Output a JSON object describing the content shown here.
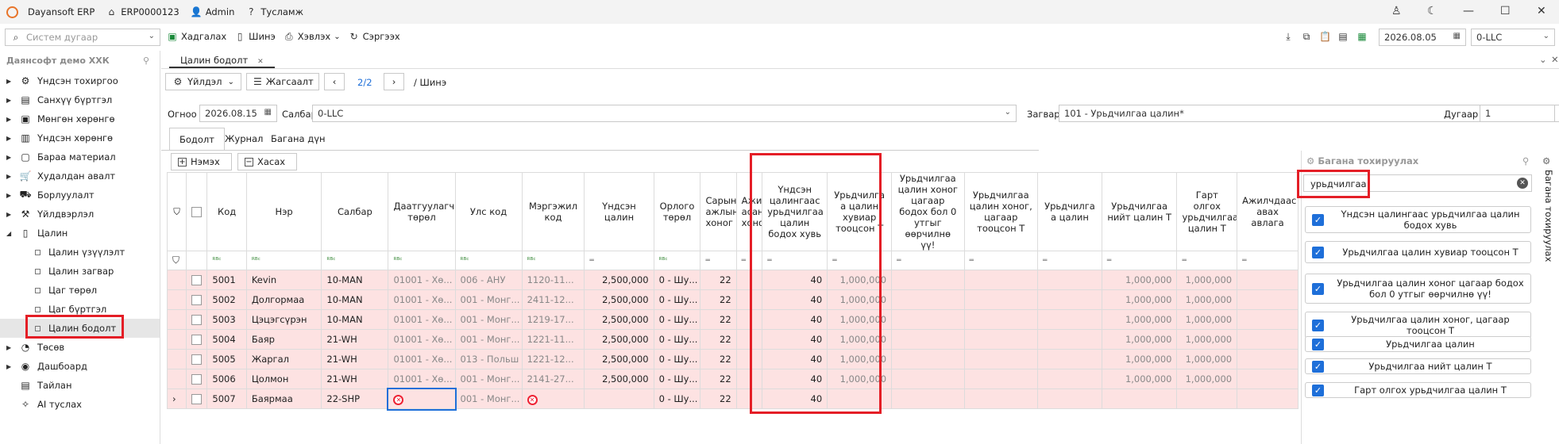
{
  "titlebar": {
    "app": "Dayansoft ERP",
    "code": "ERP0000123",
    "user": "Admin",
    "help": "Тусламж"
  },
  "toolbar": {
    "search_placeholder": "Систем дугаар",
    "save": "Хадгалах",
    "new": "Шинэ",
    "print": "Хэвлэх",
    "refresh": "Сэргээх",
    "date": "2026.08.05",
    "branch": "0-LLC"
  },
  "sidebar": {
    "company": "Даянсофт демо ХХК",
    "items": [
      "Үндсэн тохиргоо",
      "Санхүү бүртгэл",
      "Мөнгөн хөрөнгө",
      "Үндсэн хөрөнгө",
      "Бараа материал",
      "Худалдан авалт",
      "Борлуулалт",
      "Үйлдвэрлэл",
      "Цалин"
    ],
    "subitems": [
      "Цалин үзүүлэлт",
      "Цалин загвар",
      "Цаг төрөл",
      "Цаг бүртгэл",
      "Цалин бодолт"
    ],
    "bottom": [
      "Төсөв",
      "Дашбоард",
      "Тайлан",
      "AI туслах"
    ]
  },
  "main": {
    "tab": "Цалин бодолт",
    "action": "Үйлдэл",
    "list": "Жагсаалт",
    "pager": "2/2",
    "crumb": "/ Шинэ",
    "form": {
      "date_label": "Огноо",
      "date": "2026.08.15",
      "branch_label": "Салбар",
      "branch": "0-LLC",
      "template_label": "Загвар",
      "template": "101 - Урьдчилгаа цалин*",
      "num_label": "Дугаар",
      "num": "1"
    },
    "subtabs": [
      "Бодолт",
      "Журнал",
      "Багана дүн"
    ],
    "add": "Нэмэх",
    "remove": "Хасах"
  },
  "grid": {
    "headers": [
      "Код",
      "Нэр",
      "Салбар",
      "Даатгуулагч төрөл",
      "Улс код",
      "Мэргэжил код",
      "Үндсэн цалин",
      "Орлого төрөл",
      "Сарын ажлын хоног",
      "Ажилл асан хоног",
      "Үндсэн цалингаас урьдчилгаа цалин бодох хувь",
      "Урьдчилга а цалин хувиар тооцсон Т",
      "Урьдчилгаа цалин хоног цагаар бодох бол 0 утгыг өөрчилнө үү!",
      "Урьдчилгаа цалин хоног, цагаар тооцсон Т",
      "Урьдчилга а цалин",
      "Урьдчилгаа нийт цалин Т",
      "Гарт олгох урьдчилгаа цалин Т",
      "Ажилчдаас авах авлага"
    ],
    "filter_mark": "ᴿᴮᶜ",
    "rows": [
      {
        "code": "5001",
        "name": "Kevin",
        "branch": "10-MAN",
        "ins": "01001 - Хө...",
        "country": "006 - АНУ",
        "prof": "1120-11...",
        "salary": "2,500,000",
        "inc": "0 - Шу...",
        "days": "22",
        "pct": "40",
        "adv": "1,000,000",
        "total": "1,000,000",
        "net": "1,000,000"
      },
      {
        "code": "5002",
        "name": "Долгормаа",
        "branch": "10-MAN",
        "ins": "01001 - Хө...",
        "country": "001 - Монг...",
        "prof": "2411-12...",
        "salary": "2,500,000",
        "inc": "0 - Шу...",
        "days": "22",
        "pct": "40",
        "adv": "1,000,000",
        "total": "1,000,000",
        "net": "1,000,000"
      },
      {
        "code": "5003",
        "name": "Цэцэгсүрэн",
        "branch": "10-MAN",
        "ins": "01001 - Хө...",
        "country": "001 - Монг...",
        "prof": "1219-17...",
        "salary": "2,500,000",
        "inc": "0 - Шу...",
        "days": "22",
        "pct": "40",
        "adv": "1,000,000",
        "total": "1,000,000",
        "net": "1,000,000"
      },
      {
        "code": "5004",
        "name": "Баяр",
        "branch": "21-WH",
        "ins": "01001 - Хө...",
        "country": "001 - Монг...",
        "prof": "1221-11...",
        "salary": "2,500,000",
        "inc": "0 - Шу...",
        "days": "22",
        "pct": "40",
        "adv": "1,000,000",
        "total": "1,000,000",
        "net": "1,000,000"
      },
      {
        "code": "5005",
        "name": "Жаргал",
        "branch": "21-WH",
        "ins": "01001 - Хө...",
        "country": "013 - Польш",
        "prof": "1221-12...",
        "salary": "2,500,000",
        "inc": "0 - Шу...",
        "days": "22",
        "pct": "40",
        "adv": "1,000,000",
        "total": "1,000,000",
        "net": "1,000,000"
      },
      {
        "code": "5006",
        "name": "Цолмон",
        "branch": "21-WH",
        "ins": "01001 - Хө...",
        "country": "001 - Монг...",
        "prof": "2141-27...",
        "salary": "2,500,000",
        "inc": "0 - Шу...",
        "days": "22",
        "pct": "40",
        "adv": "1,000,000",
        "total": "1,000,000",
        "net": "1,000,000"
      },
      {
        "code": "5007",
        "name": "Баярмаа",
        "branch": "22-SHP",
        "ins": "",
        "country": "001 - Монг...",
        "prof": "",
        "salary": "",
        "inc": "0 - Шу...",
        "days": "22",
        "pct": "40",
        "adv": "",
        "total": "",
        "net": ""
      }
    ]
  },
  "colpanel": {
    "title": "Багана тохируулах",
    "search": "урьдчилгаа",
    "vtab": "Багана тохируулах",
    "items": [
      "Үндсэн цалингаас урьдчилгаа цалин бодох хувь",
      "Урьдчилгаа цалин хувиар тооцсон Т",
      "Урьдчилгаа цалин хоног цагаар бодох бол 0 утгыг өөрчилнө үү!",
      "Урьдчилгаа цалин хоног, цагаар тооцсон Т",
      "Урьдчилгаа цалин",
      "Урьдчилгаа нийт цалин Т",
      "Гарт олгох урьдчилгаа цалин Т"
    ]
  }
}
